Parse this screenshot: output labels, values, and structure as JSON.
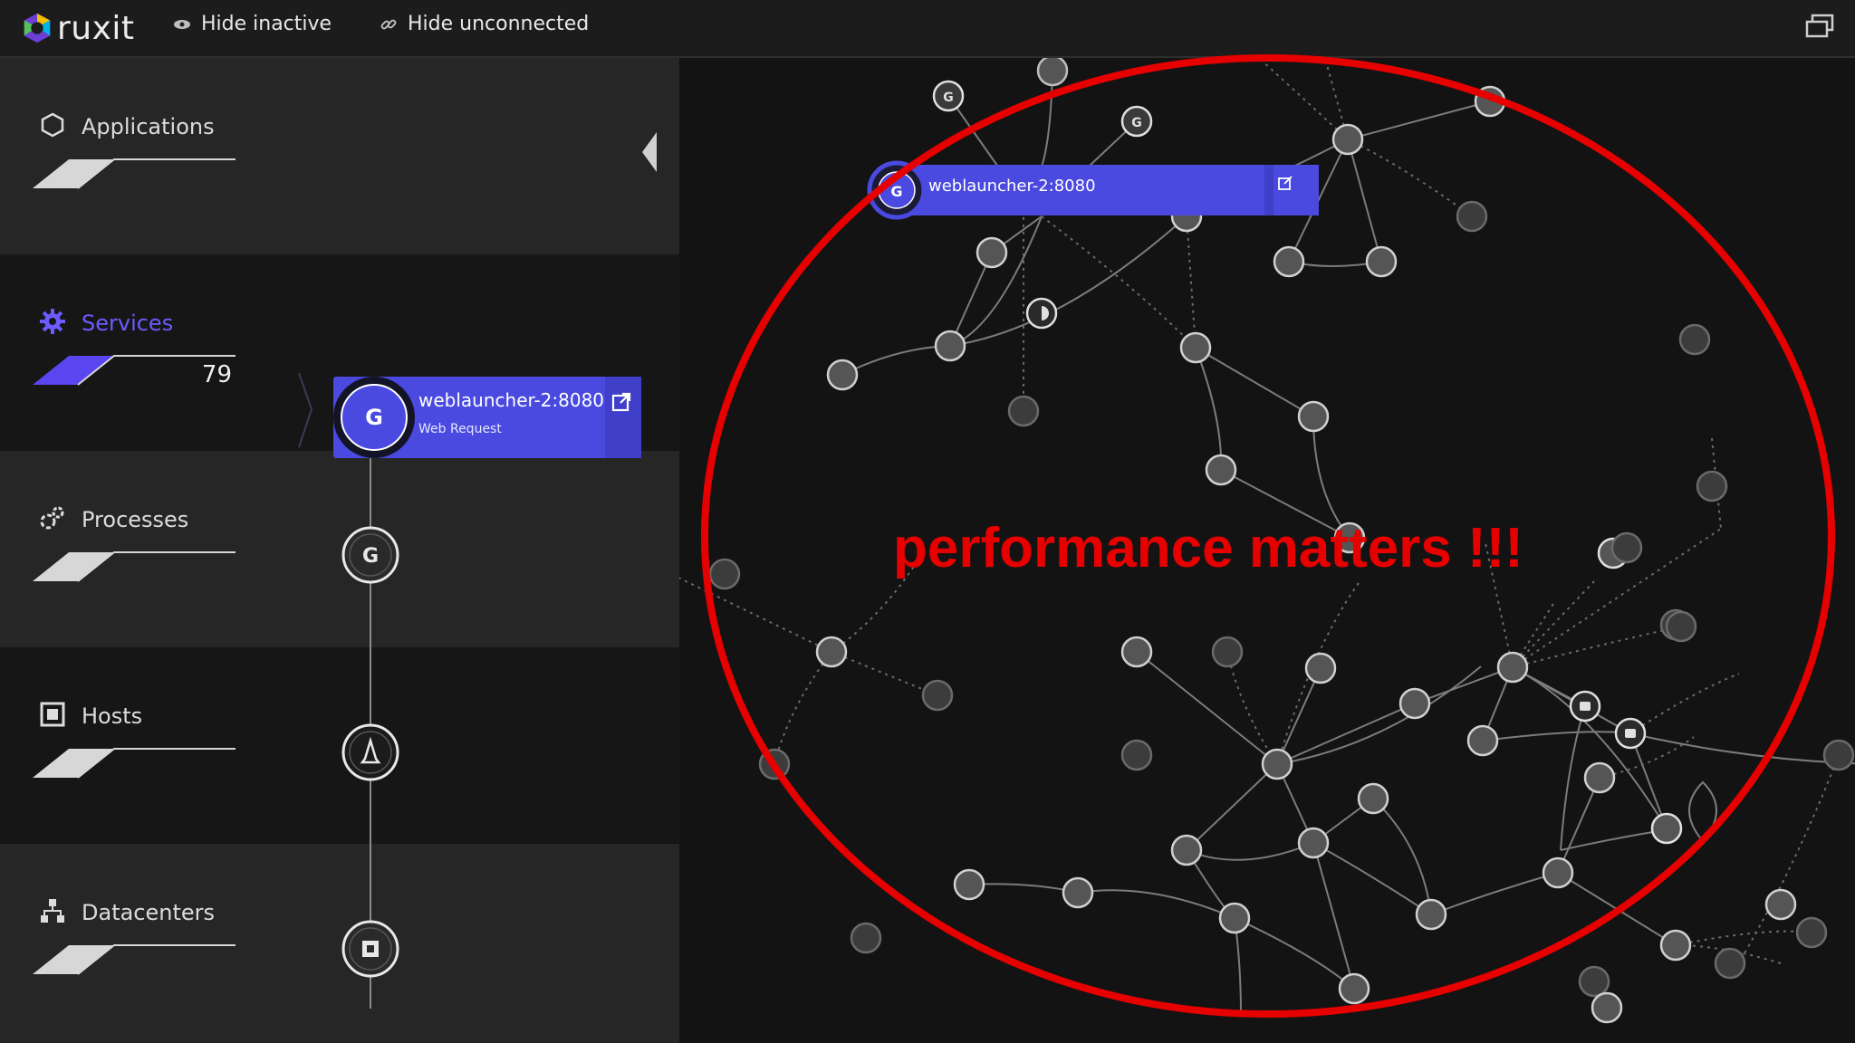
{
  "app": {
    "brand": "ruxit"
  },
  "topbar": {
    "hide_inactive_label": "Hide inactive",
    "hide_unconnected_label": "Hide unconnected"
  },
  "sidebar": {
    "bands": [
      {
        "key": "applications",
        "label": "Applications",
        "icon": "hexagon-icon",
        "active": false
      },
      {
        "key": "services",
        "label": "Services",
        "icon": "gear-icon",
        "count": "79",
        "active": true
      },
      {
        "key": "processes",
        "label": "Processes",
        "icon": "processes-icon",
        "active": false
      },
      {
        "key": "hosts",
        "label": "Hosts",
        "icon": "host-icon",
        "active": false
      },
      {
        "key": "datacenters",
        "label": "Datacenters",
        "icon": "datacenter-icon",
        "active": false
      }
    ]
  },
  "service_card": {
    "name": "weblauncher-2:8080",
    "subtitle": "Web Request"
  },
  "graph": {
    "highlight_label": "weblauncher-2:8080"
  },
  "annotation": {
    "text": "performance matters !!!",
    "color": "#e60000"
  },
  "colors": {
    "accent": "#4a4ae0",
    "active_text": "#6d5bff",
    "background": "#131313"
  }
}
